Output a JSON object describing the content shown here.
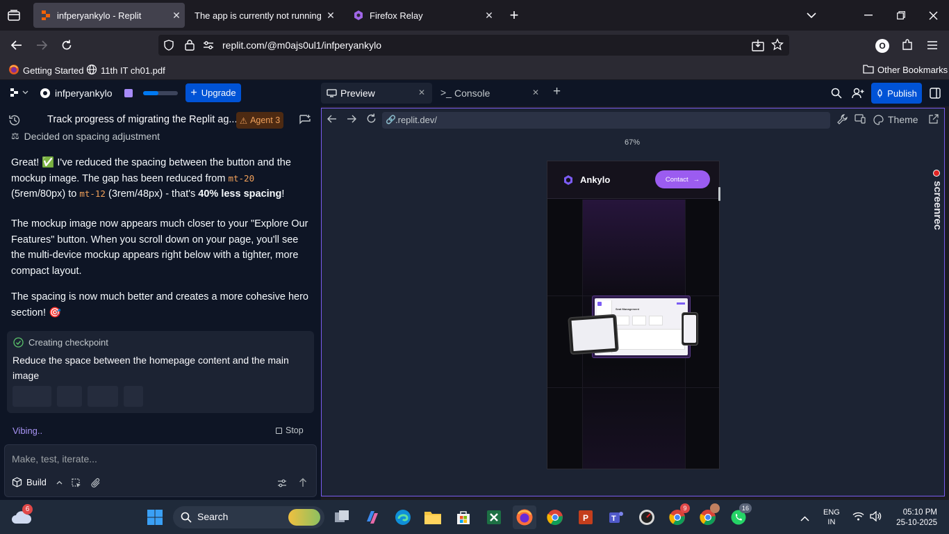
{
  "browser": {
    "tabs": [
      {
        "title": "infperyankylo - Replit",
        "active": true
      },
      {
        "title": "The app is currently not running. De",
        "active": false
      },
      {
        "title": "Firefox Relay",
        "active": false
      }
    ],
    "url": "replit.com/@m0ajs0ul1/infperyankylo",
    "bookmarks": [
      "Getting Started",
      "11th IT ch01.pdf"
    ],
    "other_bookmarks": "Other Bookmarks",
    "profile_initial": "O"
  },
  "replit": {
    "project_name": "infperyankylo",
    "upgrade_label": "Upgrade",
    "tabs": {
      "preview": "Preview",
      "console": "Console"
    },
    "publish_label": "Publish",
    "thread_title": "Track progress of migrating the Replit ag...",
    "agent_badge": "Agent 3",
    "decision": "Decided on spacing adjustment",
    "message": {
      "p1_a": "Great! ✅ I've reduced the spacing between the button and the mockup image. The gap has been reduced from ",
      "code1": "mt-20",
      "p1_b": "(5rem/80px) to ",
      "code2": "mt-12",
      "p1_c": " (3rem/48px) - that's ",
      "p1_bold": "40% less spacing",
      "p1_d": "!",
      "p2": "The mockup image now appears much closer to your \"Explore Our Features\" button. When you scroll down on your page, you'll see the multi-device mockup appears right below with a tighter, more compact layout.",
      "p3": "The spacing is now much better and creates a more cohesive hero section! 🎯"
    },
    "checkpoint": {
      "label": "Creating checkpoint",
      "text": "Reduce the space between the homepage content and the main image"
    },
    "status": "Vibing..",
    "stop_label": "Stop",
    "input_placeholder": "Make, test, iterate...",
    "build_label": "Build",
    "preview": {
      "url": ".replit.dev/",
      "theme_label": "Theme",
      "zoom": "67%",
      "site_brand": "Ankylo",
      "contact_label": "Contact",
      "mockup_title": "Seat Management",
      "watermark": "screenrec"
    }
  },
  "taskbar": {
    "search_label": "Search",
    "weather_badge": "6",
    "chrome_badge": "9",
    "whatsapp_badge": "16",
    "lang": "ENG",
    "region": "IN",
    "time": "05:10 PM",
    "date": "25-10-2025"
  },
  "colors": {
    "accent_purple": "#7c5cf4",
    "upgrade_blue": "#0053d6",
    "agent_badge": "#f0a05a",
    "code_orange": "#f0a05a"
  }
}
